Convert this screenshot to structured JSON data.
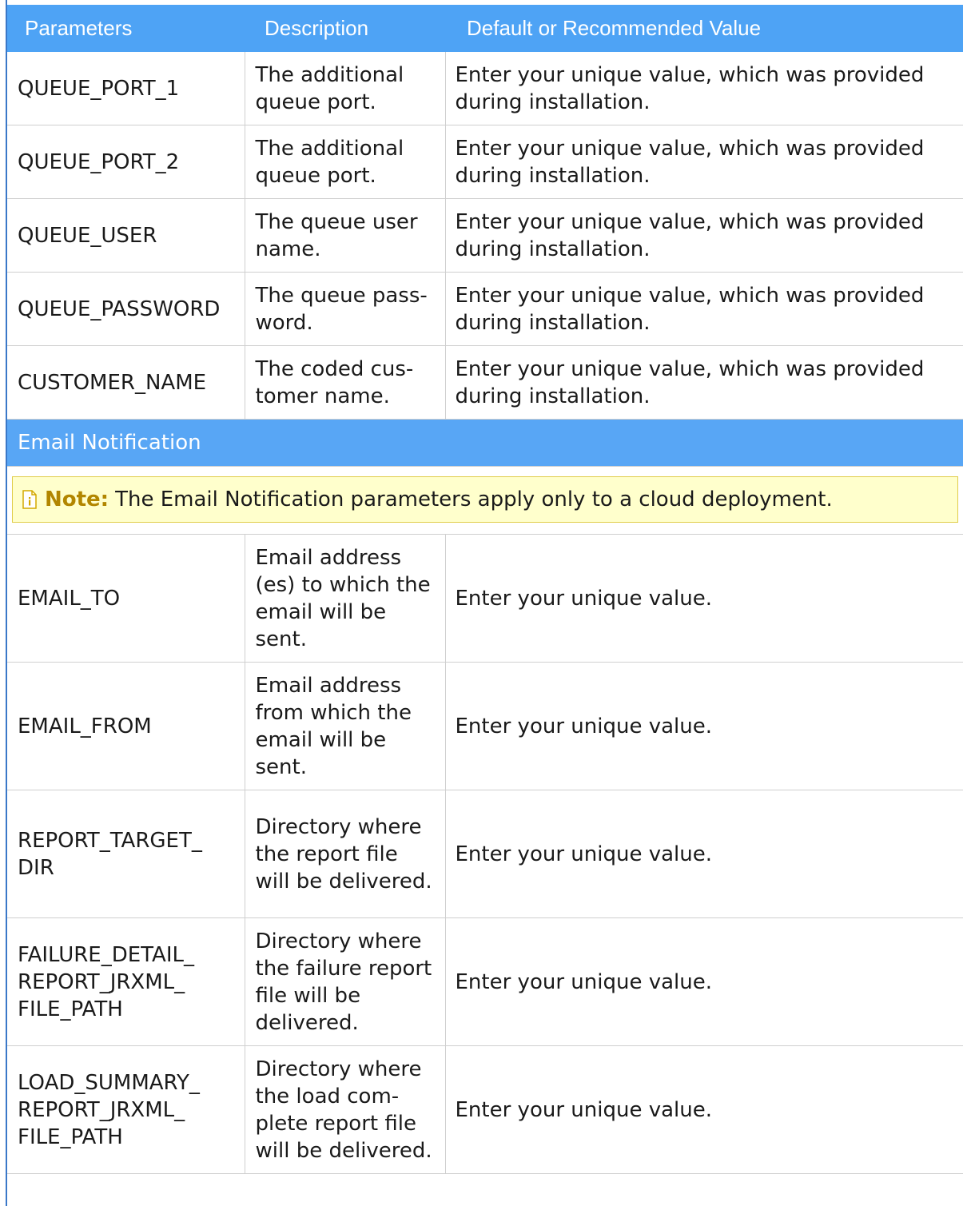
{
  "table": {
    "headers": [
      "Parameters",
      "Description",
      "Default or Recommended Value"
    ],
    "rows_top": [
      {
        "param": "QUEUE_PORT_1",
        "desc": "The additional queue port.",
        "value": "Enter your unique value, which was provided during installation."
      },
      {
        "param": "QUEUE_PORT_2",
        "desc": "The additional queue port.",
        "value": "Enter your unique value, which was provided during installation."
      },
      {
        "param": "QUEUE_USER",
        "desc": "The queue user name.",
        "value": "Enter your unique value, which was provided during installation."
      },
      {
        "param": "QUEUE_PASSWORD",
        "desc": "The queue pass-word.",
        "value": "Enter your unique value, which was provided during installation."
      },
      {
        "param": "CUSTOMER_NAME",
        "desc": "The coded cus-tomer name.",
        "value": "Enter your unique value, which was provided during installation."
      }
    ],
    "section": {
      "title": "Email Notification",
      "note_label": "Note:",
      "note_text": "The Email Notification parameters apply only to a cloud deployment."
    },
    "rows_email": [
      {
        "param": "EMAIL_TO",
        "desc": "Email address (es) to which the email will be sent.",
        "value": "Enter your unique value."
      },
      {
        "param": "EMAIL_FROM",
        "desc": "Email address from which the email will be sent.",
        "value": "Enter your unique value."
      },
      {
        "param": "REPORT_TARGET_ DIR",
        "desc": "Directory where the report file will be delivered.",
        "value": "Enter your unique value."
      },
      {
        "param": "FAILURE_DETAIL_ REPORT_JRXML_ FILE_PATH",
        "desc": "Directory where the failure report file will be delivered.",
        "value": "Enter your unique value."
      },
      {
        "param": "LOAD_SUMMARY_ REPORT_JRXML_ FILE_PATH",
        "desc": "Directory where the load com-plete report file will be delivered.",
        "value": "Enter your unique value."
      }
    ]
  },
  "colors": {
    "header_bg": "#4ea3f5",
    "section_bg": "#58a6f5",
    "note_bg": "#ffffcc",
    "note_label": "#b28600",
    "left_rule": "#3a78c8"
  },
  "icons": {
    "note": "note-info-icon"
  }
}
